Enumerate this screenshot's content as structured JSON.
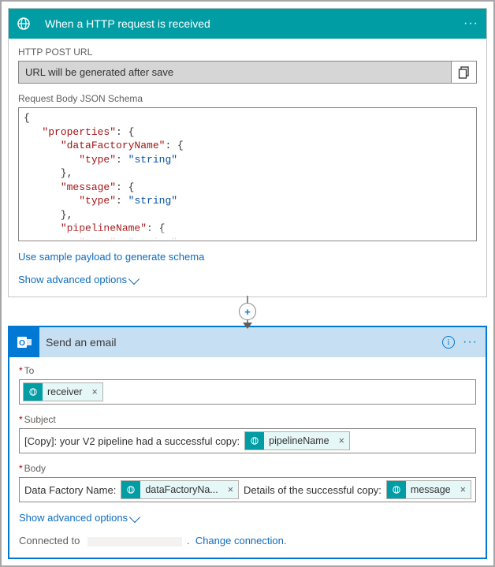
{
  "http": {
    "title": "When a HTTP request is received",
    "url_label": "HTTP POST URL",
    "url_value": "URL will be generated after save",
    "schema_label": "Request Body JSON Schema",
    "schema_json": "{\n   \"properties\": {\n      \"dataFactoryName\": {\n         \"type\": \"string\"\n      },\n      \"message\": {\n         \"type\": \"string\"\n      },\n      \"pipelineName\": {\n         \"type\": \"string\"",
    "sample_link": "Use sample payload to generate schema",
    "advanced_link": "Show advanced options"
  },
  "email": {
    "title": "Send an email",
    "to_label": "To",
    "to_tokens": [
      {
        "label": "receiver"
      }
    ],
    "subject_label": "Subject",
    "subject_prefix": "[Copy]: your V2 pipeline had a successful copy:",
    "subject_tokens": [
      {
        "label": "pipelineName"
      }
    ],
    "body_label": "Body",
    "body_parts": {
      "prefix": "Data Factory Name:",
      "token1": "dataFactoryNa...",
      "mid": "Details of the successful copy:",
      "token2": "message"
    },
    "advanced_link": "Show advanced options",
    "connected_prefix": "Connected to",
    "connected_value": "",
    "change_conn": "Change connection."
  }
}
